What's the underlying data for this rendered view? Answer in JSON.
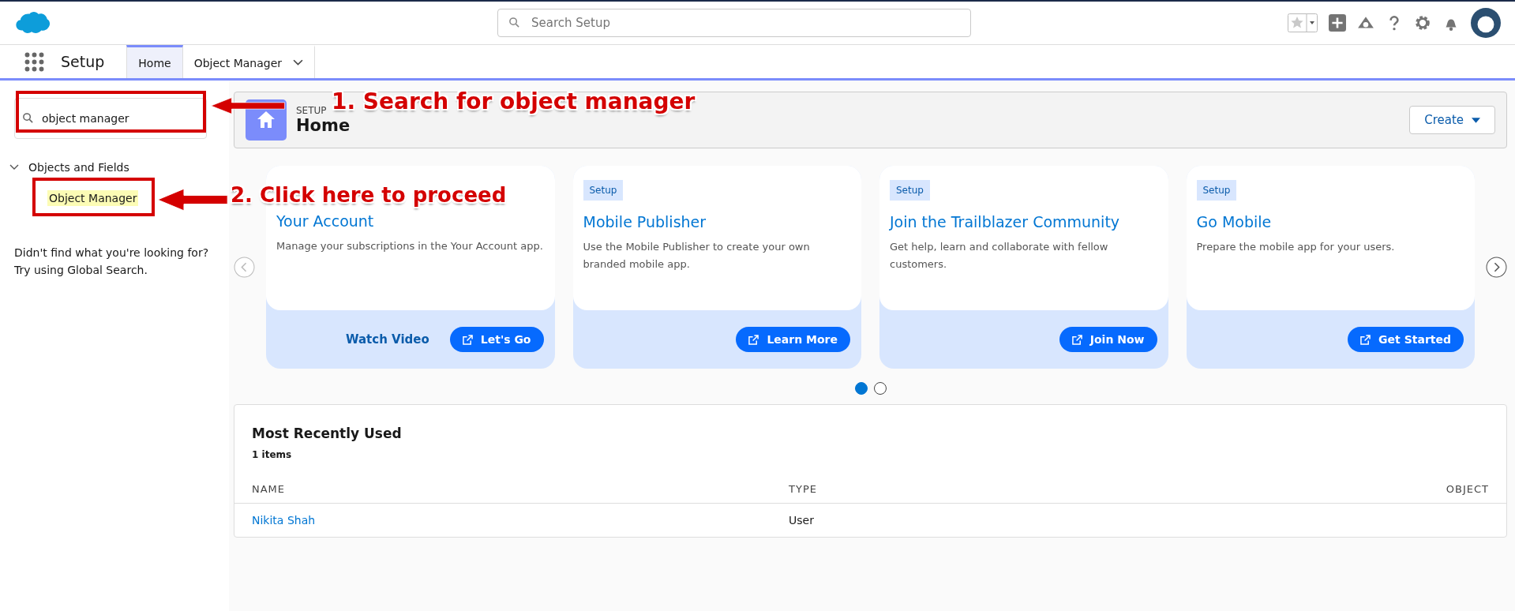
{
  "header": {
    "search": {
      "placeholder": "Search Setup"
    }
  },
  "nav": {
    "app_name": "Setup",
    "tabs": [
      {
        "label": "Home",
        "selected": true,
        "has_menu": false
      },
      {
        "label": "Object Manager",
        "selected": false,
        "has_menu": true
      }
    ]
  },
  "sidebar": {
    "search": {
      "value": "object manager"
    },
    "tree": [
      {
        "label": "Objects and Fields",
        "expanded": true,
        "children": [
          {
            "label": "Object Manager",
            "highlighted": true
          }
        ]
      }
    ],
    "help_lines": [
      "Didn't find what you're looking for?",
      "Try using Global Search."
    ]
  },
  "page_header": {
    "eyebrow": "SETUP",
    "title": "Home",
    "create_button": "Create"
  },
  "cards": [
    {
      "title": "Your Account",
      "description": "Manage your subscriptions in the Your Account app.",
      "link": "Watch Video",
      "button": "Let's Go"
    },
    {
      "badge": "Setup",
      "title": "Mobile Publisher",
      "description": "Use the Mobile Publisher to create your own branded mobile app.",
      "button": "Learn More"
    },
    {
      "badge": "Setup",
      "title": "Join the Trailblazer Community",
      "description": "Get help, learn and collaborate with fellow customers.",
      "button": "Join Now"
    },
    {
      "badge": "Setup",
      "title": "Go Mobile",
      "description": "Prepare the mobile app for your users.",
      "button": "Get Started"
    }
  ],
  "carousel_dots": [
    {
      "selected": true
    },
    {
      "selected": false
    }
  ],
  "recent": {
    "title": "Most Recently Used",
    "count": "1 items",
    "columns": [
      "NAME",
      "TYPE",
      "OBJECT"
    ],
    "rows": [
      [
        "Nikita Shah",
        "User",
        ""
      ]
    ]
  },
  "annotations": [
    "1. Search for object manager",
    "2. Click here to proceed"
  ]
}
